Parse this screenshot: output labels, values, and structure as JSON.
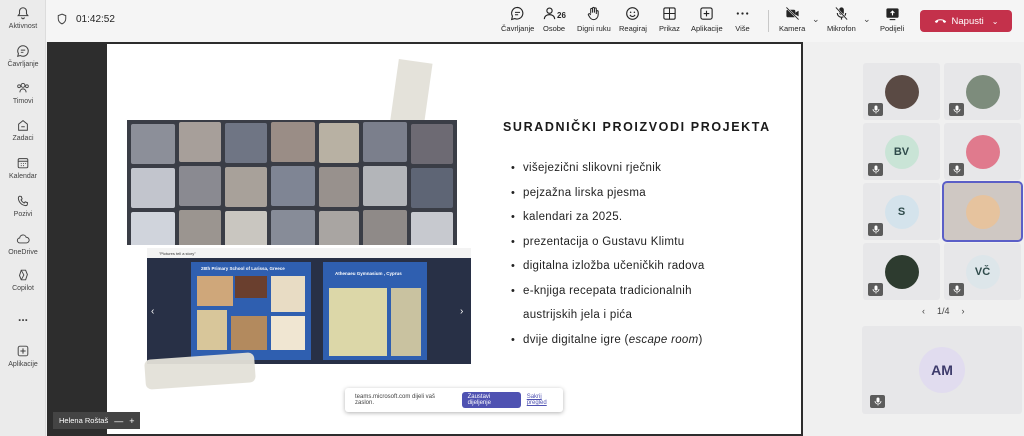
{
  "rail": [
    {
      "label": "Aktivnost",
      "icon": "bell-icon"
    },
    {
      "label": "Čavrljanje",
      "icon": "chat-icon"
    },
    {
      "label": "Timovi",
      "icon": "teams-icon"
    },
    {
      "label": "Zadaci",
      "icon": "assignments-icon"
    },
    {
      "label": "Kalendar",
      "icon": "calendar-icon"
    },
    {
      "label": "Pozivi",
      "icon": "phone-icon"
    },
    {
      "label": "OneDrive",
      "icon": "cloud-icon"
    },
    {
      "label": "Copilot",
      "icon": "copilot-icon"
    },
    {
      "label": "...",
      "icon": "more-icon"
    },
    {
      "label": "Aplikacije",
      "icon": "apps-icon"
    }
  ],
  "meeting": {
    "timer": "01:42:52"
  },
  "toolbar": {
    "chat": "Čavrljanje",
    "people": "Osobe",
    "people_count": "26",
    "raise_hand": "Digni ruku",
    "react": "Reagiraj",
    "view": "Prikaz",
    "apps": "Aplikacije",
    "more": "Više",
    "camera": "Kamera",
    "mic": "Mikrofon",
    "share": "Podijeli",
    "leave": "Napusti"
  },
  "slide": {
    "title": "SURADNIČKI PROIZVODI PROJEKTA",
    "bullets": [
      "višejezični slikovni rječnik",
      "pejzažna lirska pjesma",
      "kalendari za 2025.",
      "prezentacija o Gustavu Klimtu",
      "digitalna izložba učeničkih radova",
      "e-knjiga recepata tradicionalnih",
      "austrijskih jela i pića",
      "dvije digitalne igre (escape room)"
    ],
    "embed_header": "\"Pictures tell a story\"",
    "embed_left": "28th Primary School of Larissa, Greece",
    "embed_right": "Athenaeu Gymnasium , Cyprus"
  },
  "share_banner": {
    "text": "teams.microsoft.com dijeli vaš zaslon.",
    "stop": "Zaustavi dijeljenje",
    "hide": "Sakrij pregled"
  },
  "presenter": {
    "name": "Helena Roštaš"
  },
  "gallery": {
    "tiles": [
      {
        "initials": "",
        "kind": "photo"
      },
      {
        "initials": "",
        "kind": "photo"
      },
      {
        "initials": "BV",
        "kind": "initials"
      },
      {
        "initials": "",
        "kind": "photo"
      },
      {
        "initials": "S",
        "kind": "initials"
      },
      {
        "initials": "",
        "kind": "video"
      },
      {
        "initials": "",
        "kind": "photo"
      },
      {
        "initials": "VČ",
        "kind": "initials"
      }
    ],
    "pager": "1/4",
    "big_initials": "AM"
  },
  "colors": {
    "leave": "#c4314b",
    "accent": "#5b5fc7",
    "rail": "#ebebeb"
  }
}
